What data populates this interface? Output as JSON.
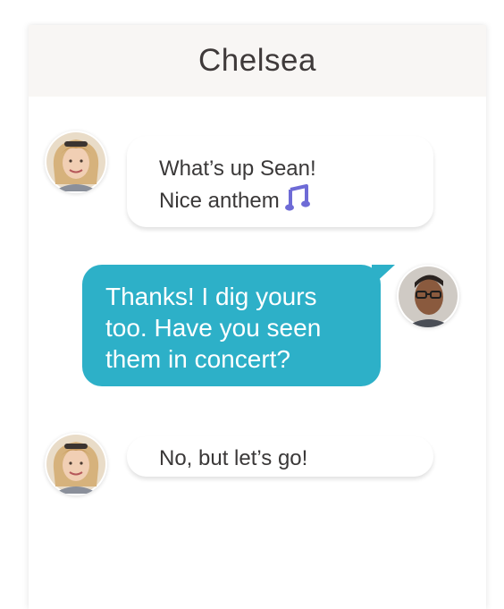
{
  "header": {
    "title": "Chelsea"
  },
  "messages": [
    {
      "sender": "Chelsea",
      "direction": "incoming",
      "lines": [
        "What’s up Sean!",
        "Nice anthem"
      ],
      "emoji": "music-notes-icon"
    },
    {
      "sender": "Sean",
      "direction": "outgoing",
      "lines": [
        "Thanks! I dig yours",
        "too. Have you seen",
        "them in concert?"
      ]
    },
    {
      "sender": "Chelsea",
      "direction": "incoming",
      "lines": [
        "No, but let’s go!"
      ]
    }
  ],
  "colors": {
    "header_bg": "#f8f6f4",
    "outgoing_bubble": "#2db0c8",
    "incoming_bubble": "#ffffff",
    "text_dark": "#3a3838",
    "music_icon": "#6e6bd6"
  }
}
